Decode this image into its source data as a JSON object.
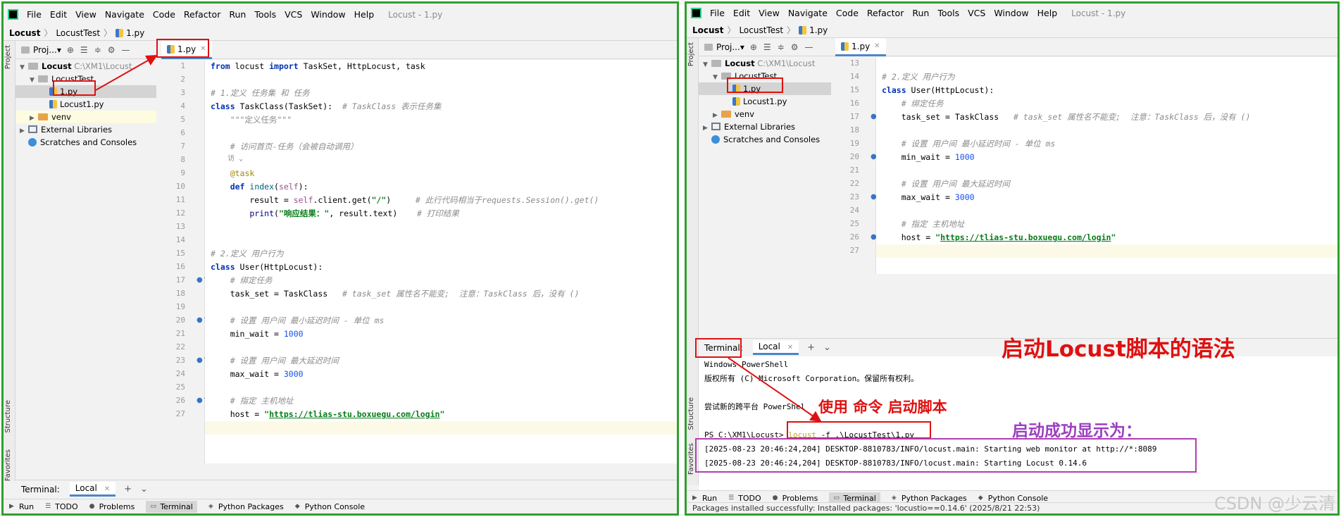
{
  "menu": [
    "File",
    "Edit",
    "View",
    "Navigate",
    "Code",
    "Refactor",
    "Run",
    "Tools",
    "VCS",
    "Window",
    "Help"
  ],
  "window_title": "Locust - 1.py",
  "breadcrumb": {
    "root": "Locust",
    "folder": "LocustTest",
    "file": "1.py"
  },
  "project_panel": {
    "label": "Proj...▾"
  },
  "project_tree": {
    "root": "Locust",
    "root_path": "C:\\XM1\\Locust",
    "folder": "LocustTest",
    "file1": "1.py",
    "file2": "Locust1.py",
    "venv": "venv",
    "libs": "External Libraries",
    "scratches": "Scratches and Consoles"
  },
  "editor_tab": "1.py",
  "left_code": {
    "c1_from": "from",
    "c1_mod": " locust ",
    "c1_import": "import",
    "c1_rest": " TaskSet, HttpLocust, task",
    "c3": "# 1.定义 任务集 和 任务",
    "c4_kw": "class",
    "c4_name": " TaskClass(TaskSet):  ",
    "c4_cm": "# TaskClass 表示任务集",
    "c5": "    \"\"\"定义任务\"\"\"",
    "c7": "    # 访问首页-任务（会被自动调用）",
    "c7_hint": "    访 ⌄",
    "c8": "    @task",
    "c9_kw": "    def",
    "c9_fn": " index",
    "c9_open": "(",
    "c9_self": "self",
    "c9_close": "):",
    "c10_a": "        result = ",
    "c10_self": "self",
    "c10_b": ".client.get(",
    "c10_st": "\"/\"",
    "c10_c": ")     ",
    "c10_cm": "# 此行代码相当于requests.Session().get()",
    "c11_print": "        print",
    "c11_open": "(",
    "c11_st": "\"响应结果：\"",
    "c11_rest": ", result.text)    ",
    "c11_cm": "# 打印结果"
  },
  "shared_code": {
    "c14": "# 2.定义 用户行为",
    "c15_kw": "class",
    "c15_rest": " User(HttpLocust):",
    "c16": "    # 绑定任务",
    "c17_a": "    task_set = TaskClass   ",
    "c17_cm": "# task_set 属性名不能变;  注意：TaskClass 后，没有 ()",
    "c19": "    # 设置 用户间 最小延迟时间 - 单位 ms",
    "c20_a": "    min_wait = ",
    "c20_num": "1000",
    "c22": "    # 设置 用户间 最大延迟时间",
    "c23_a": "    max_wait = ",
    "c23_num": "3000",
    "c25": "    # 指定 主机地址",
    "c26_a": "    host = ",
    "c26_q1": "\"",
    "c26_url": "https://tlias-stu.boxuegu.com/login",
    "c26_q2": "\""
  },
  "line_numbers_left": [
    "1",
    "2",
    "3",
    "4",
    "5",
    "6",
    "7",
    "8",
    "9",
    "10",
    "11",
    "12",
    "13",
    "14",
    "15",
    "16",
    "17",
    "18",
    "19",
    "20",
    "21",
    "22",
    "23",
    "24",
    "25",
    "26",
    "27"
  ],
  "line_numbers_right": [
    "13",
    "14",
    "15",
    "16",
    "17",
    "18",
    "19",
    "20",
    "21",
    "22",
    "23",
    "24",
    "25",
    "26",
    "27"
  ],
  "terminal": {
    "label": "Terminal:",
    "tab": "Local",
    "line1": "Windows PowerShell",
    "line2": "版权所有 (C) Microsoft Corporation。保留所有权利。",
    "line4a": "尝试新的跨平台 PowerShe",
    "line4b": "l",
    "prompt": "PS C:\\XM1\\Locust> ",
    "cmd_kw": "locust",
    "cmd_rest": " -f .\\LocustTest\\1.py",
    "log1": "[2025-08-23 20:46:24,204] DESKTOP-8810783/INFO/locust.main: Starting web monitor at http://*:8089",
    "log2": "[2025-08-23 20:46:24,204] DESKTOP-8810783/INFO/locust.main: Starting Locust 0.14.6"
  },
  "bottom_tabs": [
    "Run",
    "TODO",
    "Problems",
    "Terminal",
    "Python Packages",
    "Python Console"
  ],
  "sidebar_labels": {
    "project": "Project",
    "structure": "Structure",
    "favorites": "Favorites"
  },
  "status_text": "Packages installed successfully: Installed packages: 'locustio==0.14.6' (2025/8/21 22:53)",
  "annotations": {
    "syntax_title": "启动Locust脚本的语法",
    "use_command": "使用 命令 启动脚本",
    "success": "启动成功显示为："
  },
  "watermark": "CSDN @少云清",
  "colors": {
    "frame": "#2ea02e",
    "callout": "#e01010",
    "callout_purple": "#b23db3",
    "annotation_purple": "#9a3fc0"
  }
}
